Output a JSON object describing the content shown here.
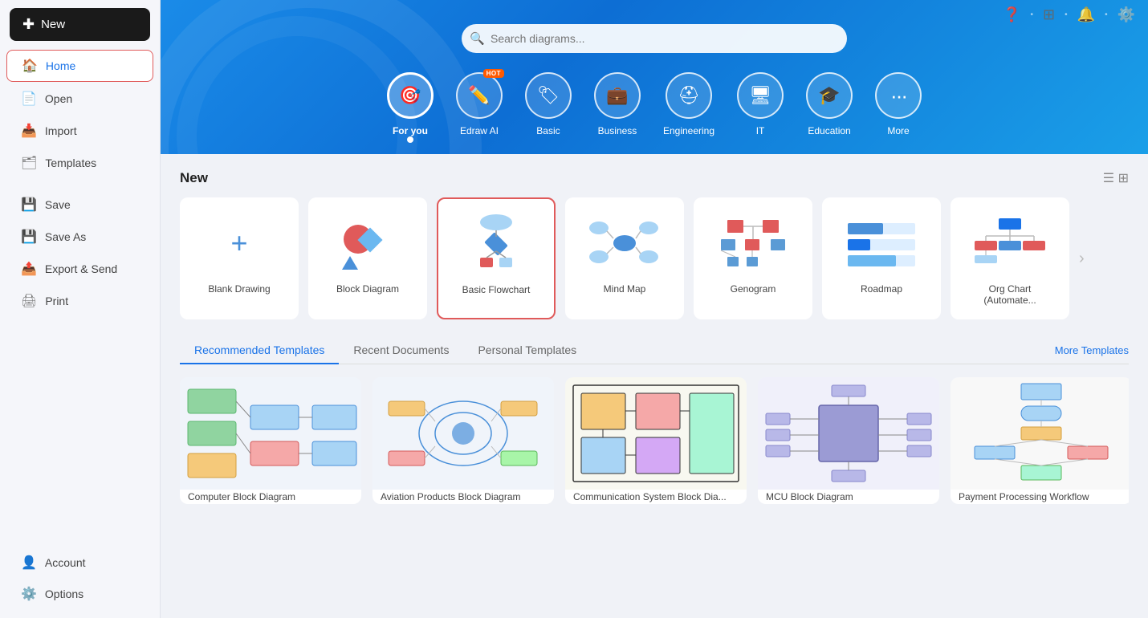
{
  "sidebar": {
    "new_label": "New",
    "items": [
      {
        "id": "home",
        "label": "Home",
        "icon": "🏠",
        "active": true
      },
      {
        "id": "open",
        "label": "Open",
        "icon": "📄"
      },
      {
        "id": "import",
        "label": "Import",
        "icon": "📥"
      },
      {
        "id": "templates",
        "label": "Templates",
        "icon": "🗂"
      },
      {
        "id": "save",
        "label": "Save",
        "icon": "💾"
      },
      {
        "id": "save-as",
        "label": "Save As",
        "icon": "💾"
      },
      {
        "id": "export",
        "label": "Export & Send",
        "icon": "📤"
      },
      {
        "id": "print",
        "label": "Print",
        "icon": "🖨"
      }
    ],
    "bottom_items": [
      {
        "id": "account",
        "label": "Account",
        "icon": "👤"
      },
      {
        "id": "options",
        "label": "Options",
        "icon": "⚙️"
      }
    ]
  },
  "topbar": {
    "icons": [
      "❓",
      "⊞",
      "🔔",
      "⚙️"
    ]
  },
  "hero": {
    "search_placeholder": "Search diagrams...",
    "categories": [
      {
        "id": "foryou",
        "label": "For you",
        "icon": "🎯",
        "active": true
      },
      {
        "id": "edrawai",
        "label": "Edraw AI",
        "icon": "✏️",
        "hot": true
      },
      {
        "id": "basic",
        "label": "Basic",
        "icon": "🏷"
      },
      {
        "id": "business",
        "label": "Business",
        "icon": "💼"
      },
      {
        "id": "engineering",
        "label": "Engineering",
        "icon": "⛑"
      },
      {
        "id": "it",
        "label": "IT",
        "icon": "🖥"
      },
      {
        "id": "education",
        "label": "Education",
        "icon": "🎓"
      },
      {
        "id": "more",
        "label": "More",
        "icon": "⋯"
      }
    ]
  },
  "new_section": {
    "title": "New",
    "blank_label": "Blank Drawing",
    "diagrams": [
      {
        "id": "block",
        "label": "Block Diagram",
        "selected": false
      },
      {
        "id": "flowchart",
        "label": "Basic Flowchart",
        "selected": true
      },
      {
        "id": "mindmap",
        "label": "Mind Map",
        "selected": false
      },
      {
        "id": "genogram",
        "label": "Genogram",
        "selected": false
      },
      {
        "id": "roadmap",
        "label": "Roadmap",
        "selected": false
      },
      {
        "id": "orgchart",
        "label": "Org Chart (Automate...",
        "selected": false
      }
    ]
  },
  "templates_section": {
    "tabs": [
      {
        "id": "recommended",
        "label": "Recommended Templates",
        "active": true
      },
      {
        "id": "recent",
        "label": "Recent Documents",
        "active": false
      },
      {
        "id": "personal",
        "label": "Personal Templates",
        "active": false
      }
    ],
    "more_label": "More Templates",
    "cards": [
      {
        "id": "computer-block",
        "label": "Computer Block Diagram"
      },
      {
        "id": "aviation",
        "label": "Aviation Products Block Diagram"
      },
      {
        "id": "communication",
        "label": "Communication System Block Dia..."
      },
      {
        "id": "mcu",
        "label": "MCU Block Diagram"
      },
      {
        "id": "payment",
        "label": "Payment Processing Workflow"
      }
    ]
  },
  "colors": {
    "accent_blue": "#1a73e8",
    "hero_bg": "#1a8be8",
    "selected_border": "#e05a5a",
    "sidebar_active_border": "#e05a5a"
  }
}
